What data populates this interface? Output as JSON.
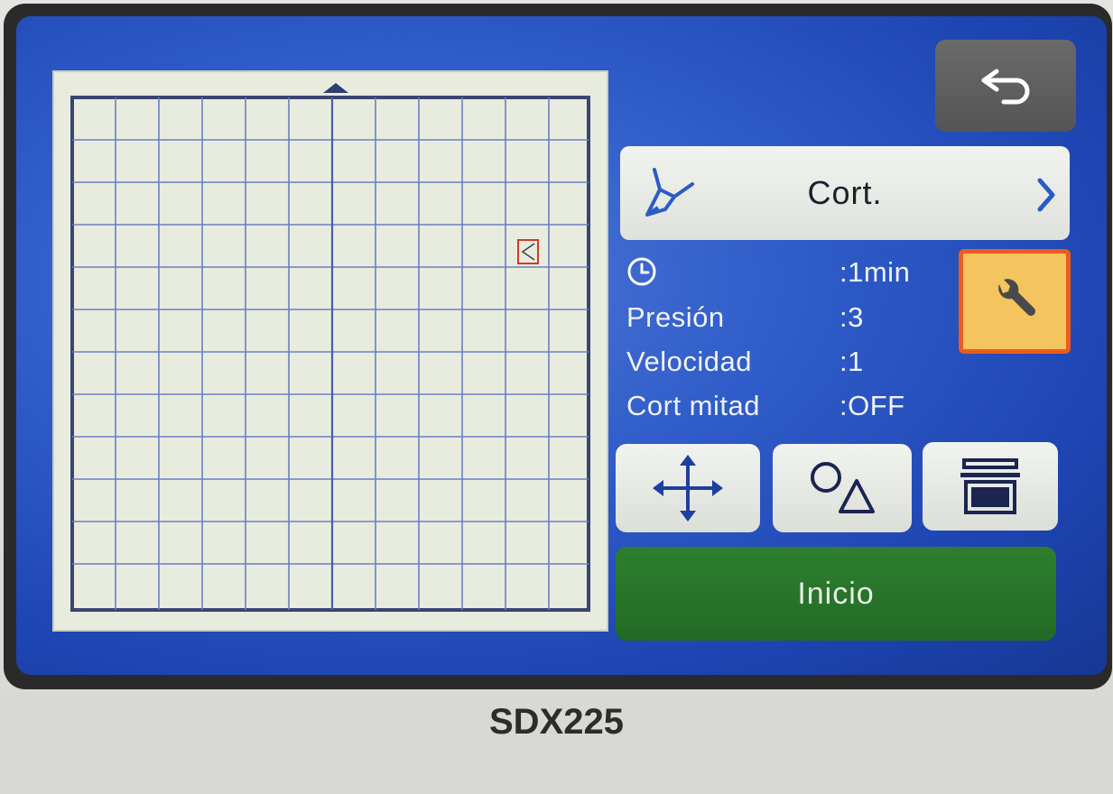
{
  "device": {
    "model": "SDX225"
  },
  "tool": {
    "label": "Cort.",
    "icon": "blade-holder-icon"
  },
  "info": {
    "time_value": ":1min",
    "rows": [
      {
        "label": "Presión",
        "value": ":3"
      },
      {
        "label": "Velocidad",
        "value": ":1"
      },
      {
        "label": "Cort mitad",
        "value": ":OFF"
      }
    ]
  },
  "buttons": {
    "back_icon": "return-arrow-icon",
    "settings_icon": "wrench-icon",
    "move_icon": "move-arrows-icon",
    "shapes_icon": "circle-triangle-icon",
    "scan_icon": "scanner-icon",
    "start_label": "Inicio"
  },
  "colors": {
    "screen_blue": "#2f5cc9",
    "settings_highlight": "#f05a1e",
    "settings_fill": "#f4c45e",
    "start_green": "#2e7f2f",
    "pattern_marker": "#d23a2a"
  }
}
